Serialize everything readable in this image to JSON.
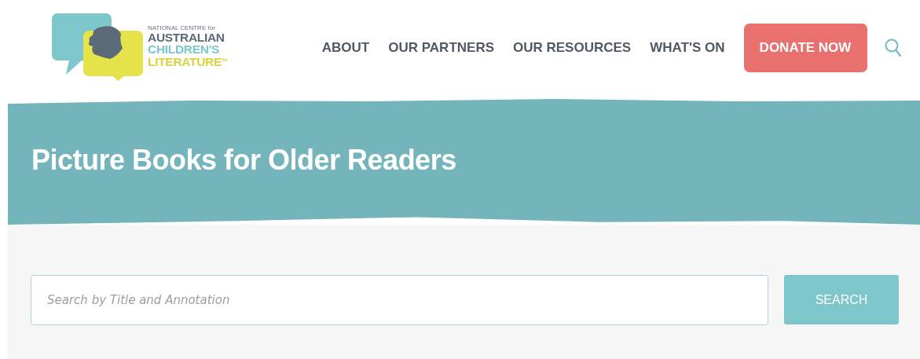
{
  "logo": {
    "line_1": "NATIONAL CENTRE for",
    "line_2": "AUSTRALIAN",
    "line_3": "CHILDREN'S",
    "line_4": "LITERATURE",
    "suffix": "Inc"
  },
  "nav": {
    "items": [
      {
        "label": "ABOUT"
      },
      {
        "label": "OUR PARTNERS"
      },
      {
        "label": "OUR RESOURCES"
      },
      {
        "label": "WHAT'S ON"
      }
    ],
    "donate_button": "DONATE NOW"
  },
  "banner": {
    "title": "Picture Books for Older Readers"
  },
  "search": {
    "placeholder": "Search by Title and Annotation",
    "button": "SEARCH"
  }
}
